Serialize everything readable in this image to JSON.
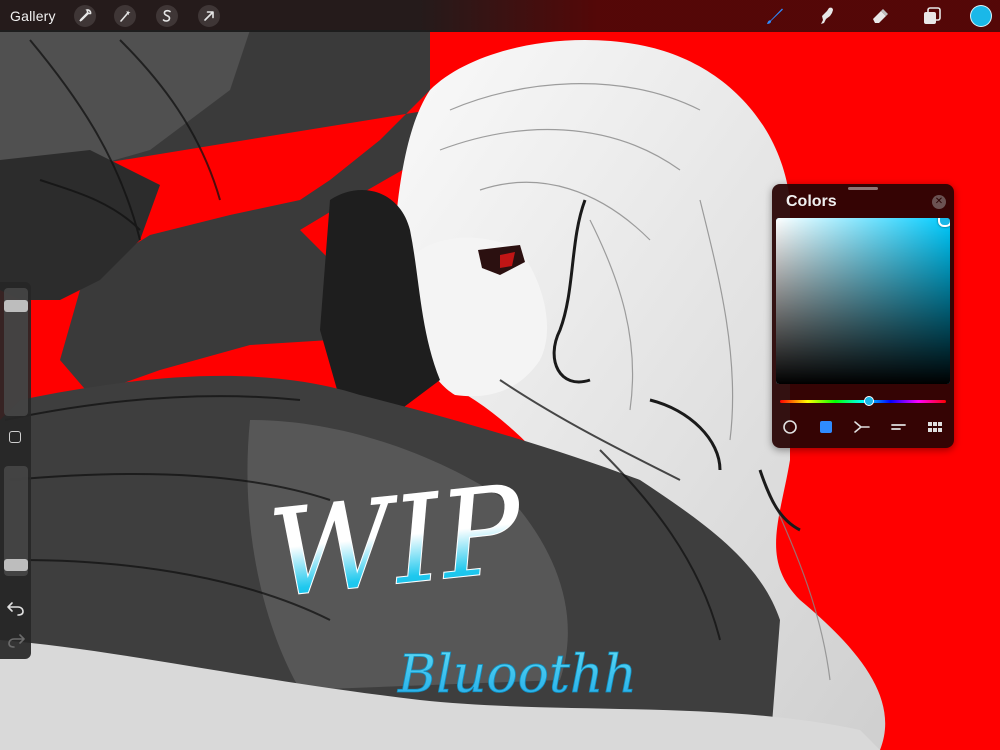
{
  "topbar": {
    "gallery_label": "Gallery",
    "left_tools": [
      {
        "name": "actions-wrench-icon"
      },
      {
        "name": "adjustments-wand-icon"
      },
      {
        "name": "selection-s-icon"
      },
      {
        "name": "transform-arrow-icon"
      }
    ],
    "right_tools": [
      {
        "name": "brush-icon",
        "active": true
      },
      {
        "name": "smudge-icon",
        "active": false
      },
      {
        "name": "eraser-icon",
        "active": false
      },
      {
        "name": "layers-icon",
        "active": false
      }
    ],
    "current_color": "#1ab8e8"
  },
  "sidebar": {
    "brush_size_level": 0.1,
    "opacity_level": 0.95,
    "undo_icon": "undo-icon",
    "redo_icon": "redo-icon"
  },
  "colors_panel": {
    "title": "Colors",
    "hue_degrees": 192,
    "saturation": 0.97,
    "brightness": 0.99,
    "modes": [
      "disc-mode-icon",
      "classic-mode-icon",
      "harmony-mode-icon",
      "value-mode-icon",
      "palettes-mode-icon"
    ],
    "active_mode": 1
  },
  "artwork": {
    "background_color": "#ff0000",
    "accent_color": "#1ec8ee",
    "text_main": "WIP",
    "text_signature": "Bluoothh"
  }
}
